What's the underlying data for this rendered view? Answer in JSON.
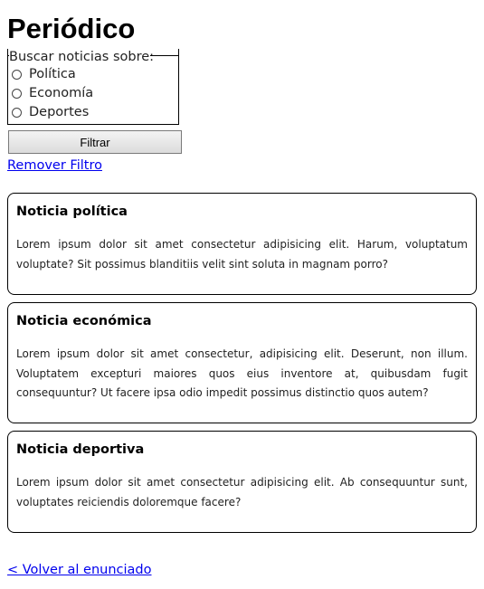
{
  "page_title": "Periódico",
  "filter": {
    "legend": "Buscar noticias sobre:",
    "options": [
      "Política",
      "Economía",
      "Deportes"
    ],
    "button_label": "Filtrar",
    "remove_link": "Remover Filtro"
  },
  "news": [
    {
      "title": "Noticia política",
      "body": "Lorem ipsum dolor sit amet consectetur adipisicing elit. Harum, voluptatum voluptate? Sit possimus blanditiis velit sint soluta in magnam porro?"
    },
    {
      "title": "Noticia económica",
      "body": "Lorem ipsum dolor sit amet consectetur, adipisicing elit. Deserunt, non illum. Voluptatem excepturi maiores quos eius inventore at, quibusdam fugit consequuntur? Ut facere ipsa odio impedit possimus distinctio quos autem?"
    },
    {
      "title": "Noticia deportiva",
      "body": "Lorem ipsum dolor sit amet consectetur adipisicing elit. Ab consequuntur sunt, voluptates reiciendis doloremque facere?"
    }
  ],
  "back_link": "< Volver al enunciado"
}
